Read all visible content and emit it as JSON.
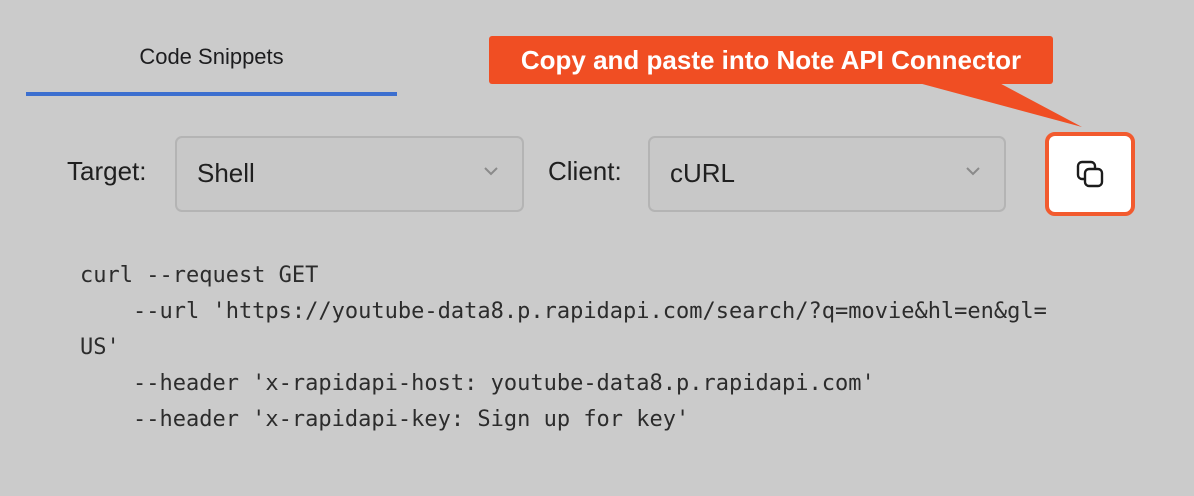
{
  "tabs": {
    "code_snippets": "Code Snippets"
  },
  "target": {
    "label": "Target:",
    "value": "Shell"
  },
  "client": {
    "label": "Client:",
    "value": "cURL"
  },
  "copy_button": {
    "icon": "copy-icon"
  },
  "callout": {
    "text": "Copy and paste into Note API Connector"
  },
  "code": {
    "lines": [
      "curl --request GET",
      "    --url 'https://youtube-data8.p.rapidapi.com/search/?q=movie&hl=en&gl=",
      "US'",
      "    --header 'x-rapidapi-host: youtube-data8.p.rapidapi.com'",
      "    --header 'x-rapidapi-key: Sign up for key'"
    ]
  },
  "colors": {
    "tab_underline": "#3c6fcf",
    "callout_bg": "#f04e23",
    "copy_border": "#f25a2e",
    "page_bg": "#cbcbcb"
  }
}
